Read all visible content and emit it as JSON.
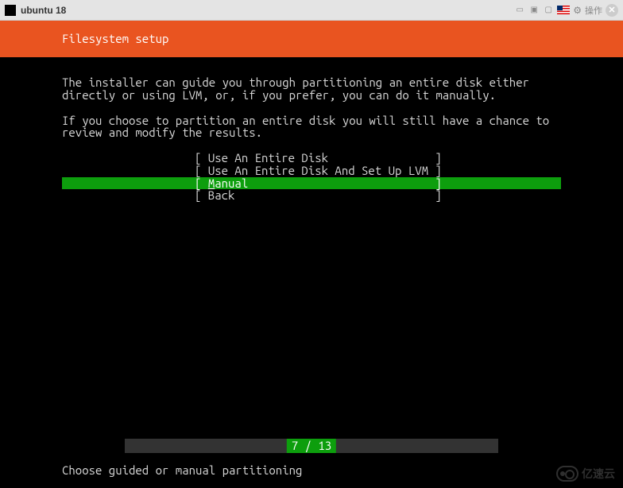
{
  "titlebar": {
    "title": "ubuntu 18",
    "action_label": "操作"
  },
  "header": {
    "title": "Filesystem setup"
  },
  "body": {
    "para1": "The installer can guide you through partitioning an entire disk either directly or using LVM, or, if you prefer, you can do it manually.",
    "para2": "If you choose to partition an entire disk you will still have a chance to review and modify the results."
  },
  "menu": {
    "items": [
      {
        "label": "Use An Entire Disk",
        "selected": false
      },
      {
        "label": "Use An Entire Disk And Set Up LVM",
        "selected": false
      },
      {
        "label": "Manual",
        "selected": true,
        "underline_first": true
      },
      {
        "label": "Back",
        "selected": false
      }
    ]
  },
  "progress": {
    "current": 7,
    "total": 13,
    "text": "7 / 13"
  },
  "status": {
    "text": "Choose guided or manual partitioning"
  },
  "watermark": {
    "text": "亿速云"
  }
}
